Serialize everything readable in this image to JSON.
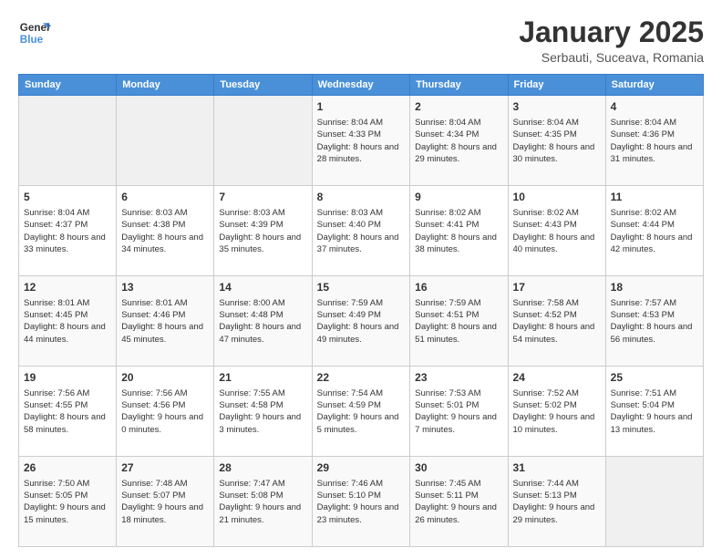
{
  "logo": {
    "name_part1": "General",
    "name_part2": "Blue"
  },
  "header": {
    "title": "January 2025",
    "subtitle": "Serbauti, Suceava, Romania"
  },
  "weekdays": [
    "Sunday",
    "Monday",
    "Tuesday",
    "Wednesday",
    "Thursday",
    "Friday",
    "Saturday"
  ],
  "weeks": [
    [
      {
        "day": "",
        "content": ""
      },
      {
        "day": "",
        "content": ""
      },
      {
        "day": "",
        "content": ""
      },
      {
        "day": "1",
        "content": "Sunrise: 8:04 AM\nSunset: 4:33 PM\nDaylight: 8 hours and 28 minutes."
      },
      {
        "day": "2",
        "content": "Sunrise: 8:04 AM\nSunset: 4:34 PM\nDaylight: 8 hours and 29 minutes."
      },
      {
        "day": "3",
        "content": "Sunrise: 8:04 AM\nSunset: 4:35 PM\nDaylight: 8 hours and 30 minutes."
      },
      {
        "day": "4",
        "content": "Sunrise: 8:04 AM\nSunset: 4:36 PM\nDaylight: 8 hours and 31 minutes."
      }
    ],
    [
      {
        "day": "5",
        "content": "Sunrise: 8:04 AM\nSunset: 4:37 PM\nDaylight: 8 hours and 33 minutes."
      },
      {
        "day": "6",
        "content": "Sunrise: 8:03 AM\nSunset: 4:38 PM\nDaylight: 8 hours and 34 minutes."
      },
      {
        "day": "7",
        "content": "Sunrise: 8:03 AM\nSunset: 4:39 PM\nDaylight: 8 hours and 35 minutes."
      },
      {
        "day": "8",
        "content": "Sunrise: 8:03 AM\nSunset: 4:40 PM\nDaylight: 8 hours and 37 minutes."
      },
      {
        "day": "9",
        "content": "Sunrise: 8:02 AM\nSunset: 4:41 PM\nDaylight: 8 hours and 38 minutes."
      },
      {
        "day": "10",
        "content": "Sunrise: 8:02 AM\nSunset: 4:43 PM\nDaylight: 8 hours and 40 minutes."
      },
      {
        "day": "11",
        "content": "Sunrise: 8:02 AM\nSunset: 4:44 PM\nDaylight: 8 hours and 42 minutes."
      }
    ],
    [
      {
        "day": "12",
        "content": "Sunrise: 8:01 AM\nSunset: 4:45 PM\nDaylight: 8 hours and 44 minutes."
      },
      {
        "day": "13",
        "content": "Sunrise: 8:01 AM\nSunset: 4:46 PM\nDaylight: 8 hours and 45 minutes."
      },
      {
        "day": "14",
        "content": "Sunrise: 8:00 AM\nSunset: 4:48 PM\nDaylight: 8 hours and 47 minutes."
      },
      {
        "day": "15",
        "content": "Sunrise: 7:59 AM\nSunset: 4:49 PM\nDaylight: 8 hours and 49 minutes."
      },
      {
        "day": "16",
        "content": "Sunrise: 7:59 AM\nSunset: 4:51 PM\nDaylight: 8 hours and 51 minutes."
      },
      {
        "day": "17",
        "content": "Sunrise: 7:58 AM\nSunset: 4:52 PM\nDaylight: 8 hours and 54 minutes."
      },
      {
        "day": "18",
        "content": "Sunrise: 7:57 AM\nSunset: 4:53 PM\nDaylight: 8 hours and 56 minutes."
      }
    ],
    [
      {
        "day": "19",
        "content": "Sunrise: 7:56 AM\nSunset: 4:55 PM\nDaylight: 8 hours and 58 minutes."
      },
      {
        "day": "20",
        "content": "Sunrise: 7:56 AM\nSunset: 4:56 PM\nDaylight: 9 hours and 0 minutes."
      },
      {
        "day": "21",
        "content": "Sunrise: 7:55 AM\nSunset: 4:58 PM\nDaylight: 9 hours and 3 minutes."
      },
      {
        "day": "22",
        "content": "Sunrise: 7:54 AM\nSunset: 4:59 PM\nDaylight: 9 hours and 5 minutes."
      },
      {
        "day": "23",
        "content": "Sunrise: 7:53 AM\nSunset: 5:01 PM\nDaylight: 9 hours and 7 minutes."
      },
      {
        "day": "24",
        "content": "Sunrise: 7:52 AM\nSunset: 5:02 PM\nDaylight: 9 hours and 10 minutes."
      },
      {
        "day": "25",
        "content": "Sunrise: 7:51 AM\nSunset: 5:04 PM\nDaylight: 9 hours and 13 minutes."
      }
    ],
    [
      {
        "day": "26",
        "content": "Sunrise: 7:50 AM\nSunset: 5:05 PM\nDaylight: 9 hours and 15 minutes."
      },
      {
        "day": "27",
        "content": "Sunrise: 7:48 AM\nSunset: 5:07 PM\nDaylight: 9 hours and 18 minutes."
      },
      {
        "day": "28",
        "content": "Sunrise: 7:47 AM\nSunset: 5:08 PM\nDaylight: 9 hours and 21 minutes."
      },
      {
        "day": "29",
        "content": "Sunrise: 7:46 AM\nSunset: 5:10 PM\nDaylight: 9 hours and 23 minutes."
      },
      {
        "day": "30",
        "content": "Sunrise: 7:45 AM\nSunset: 5:11 PM\nDaylight: 9 hours and 26 minutes."
      },
      {
        "day": "31",
        "content": "Sunrise: 7:44 AM\nSunset: 5:13 PM\nDaylight: 9 hours and 29 minutes."
      },
      {
        "day": "",
        "content": ""
      }
    ]
  ]
}
